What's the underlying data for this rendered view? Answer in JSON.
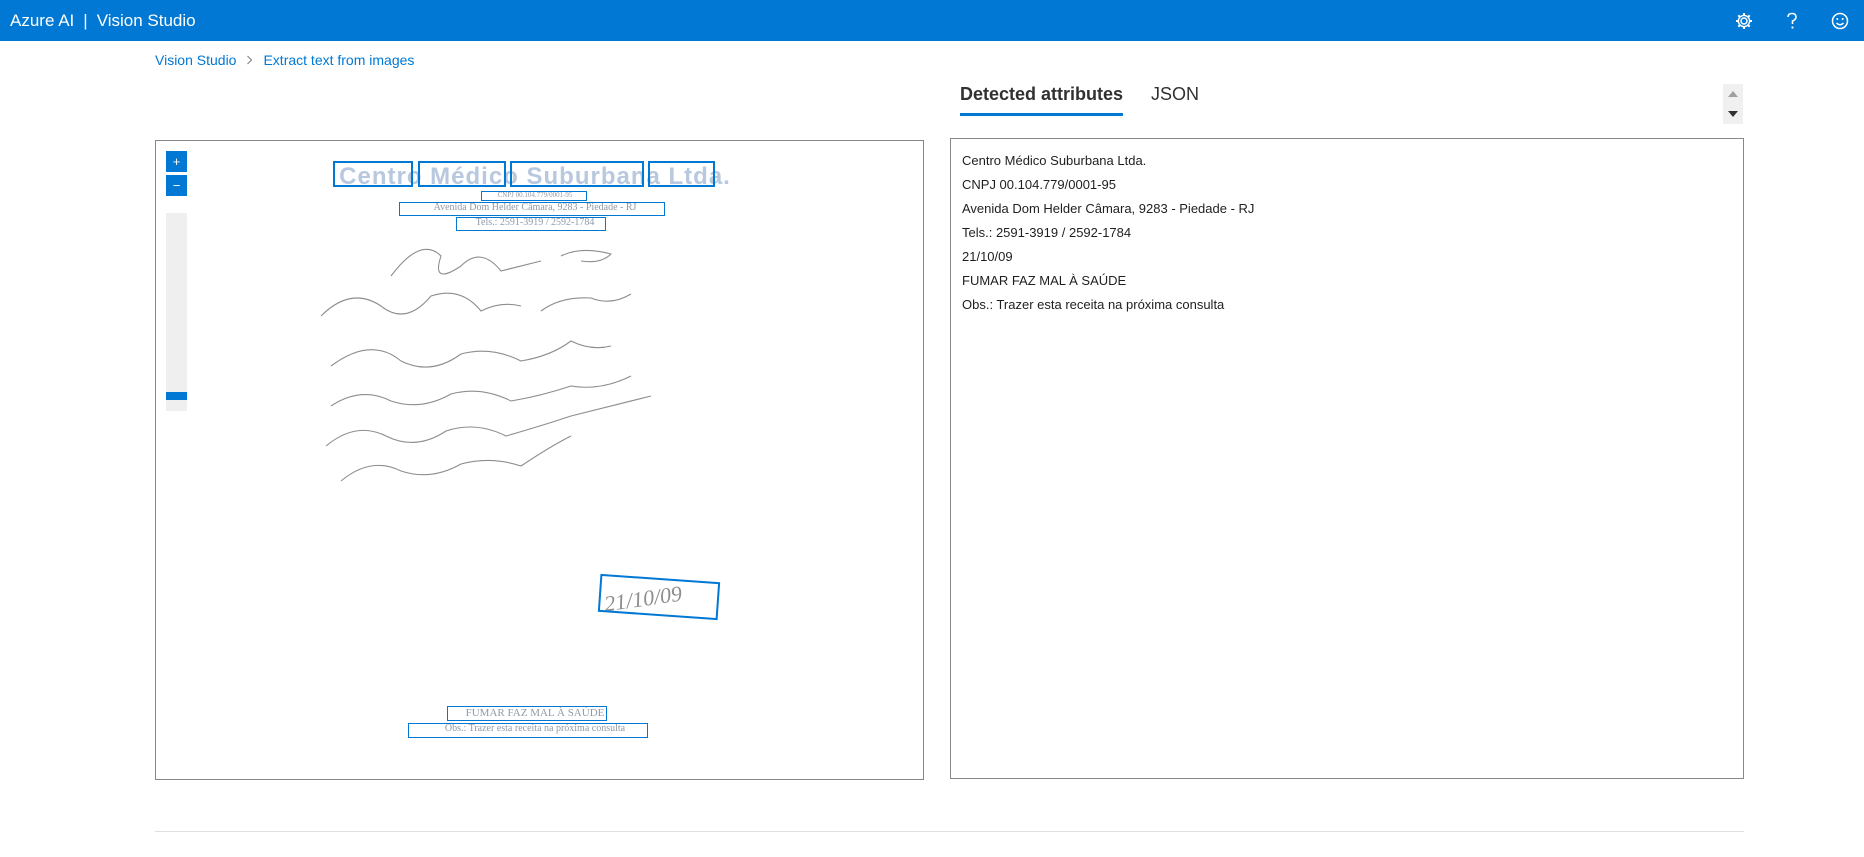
{
  "header": {
    "brand_primary": "Azure AI",
    "brand_separator": "|",
    "brand_secondary": "Vision Studio",
    "icons": [
      "gear-icon",
      "help-icon",
      "feedback-smiley-icon"
    ],
    "bar_color": "#0078d4"
  },
  "breadcrumb": {
    "items": [
      "Vision Studio",
      "Extract text from images"
    ]
  },
  "image_viewer": {
    "zoom_in": "+",
    "zoom_out": "−",
    "document": {
      "title": "Centro Médico Suburbana Ltda.",
      "cnpj": "CNPJ 00.104.779/0001-95",
      "address": "Avenida Dom Helder Câmara, 9283 - Piedade - RJ",
      "phones": "Tels.: 2591-3919 / 2592-1784",
      "date": "21/10/09",
      "warning": "FUMAR FAZ MAL À SAÚDE",
      "obs": "Obs.: Trazer esta receita na próxima consulta"
    }
  },
  "tabs": [
    {
      "label": "Detected attributes",
      "active": true
    },
    {
      "label": "JSON",
      "active": false
    }
  ],
  "attributes": {
    "lines": [
      "Centro Médico Suburbana Ltda.",
      "CNPJ 00.104.779/0001-95",
      "Avenida Dom Helder Câmara, 9283 - Piedade - RJ",
      "Tels.: 2591-3919 / 2592-1784",
      "21/10/09",
      "FUMAR FAZ MAL À SAÚDE",
      "Obs.: Trazer esta receita na próxima consulta"
    ]
  },
  "colors": {
    "accent": "#0078d4",
    "border": "#8a8886"
  }
}
